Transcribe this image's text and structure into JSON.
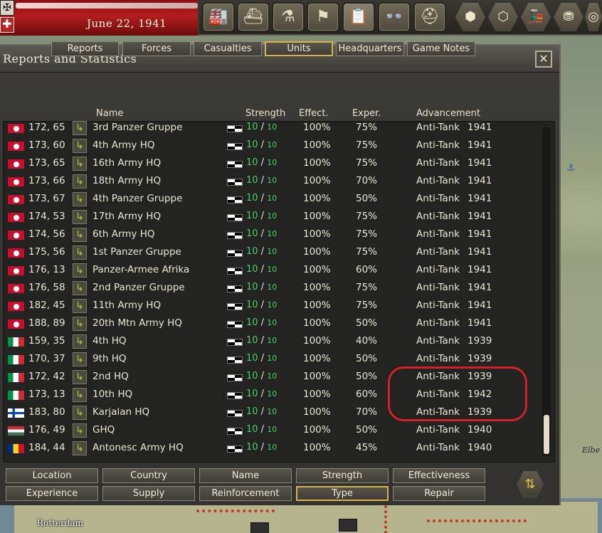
{
  "topbar": {
    "date": "June 22, 1941",
    "buttons": [
      {
        "name": "production-icon",
        "glyph": "🏭"
      },
      {
        "name": "ship-icon",
        "glyph": "⛴"
      },
      {
        "name": "research-icon",
        "glyph": "⚗"
      },
      {
        "name": "flag-icon",
        "glyph": "⚑"
      },
      {
        "name": "reports-icon",
        "glyph": "📋"
      },
      {
        "name": "binoculars-icon",
        "glyph": "👓"
      },
      {
        "name": "helmet-icon",
        "glyph": "⛑"
      }
    ],
    "hex_buttons": [
      {
        "name": "hex-view-icon",
        "glyph": "⬢"
      },
      {
        "name": "hex-grid-icon",
        "glyph": "⬡"
      },
      {
        "name": "train-icon",
        "glyph": "🚂"
      },
      {
        "name": "resources-icon",
        "glyph": "⛃"
      },
      {
        "name": "extra-icon",
        "glyph": "◎"
      }
    ]
  },
  "dialog": {
    "title": "Reports and Statistics",
    "close_glyph": "✕"
  },
  "tabs": [
    "Reports",
    "Forces",
    "Casualties",
    "Units",
    "Headquarters",
    "Game Notes"
  ],
  "active_tab": "Units",
  "columns": {
    "name": "Name",
    "strength": "Strength",
    "effect": "Effect.",
    "exper": "Exper.",
    "advancement": "Advancement"
  },
  "rows": [
    {
      "flag": "de",
      "coords": "172, 65",
      "name": "3rd Panzer Gruppe",
      "str": "10",
      "max": "10",
      "eff": "100%",
      "exp": "75%",
      "adv": "Anti-Tank",
      "year": "1941"
    },
    {
      "flag": "de",
      "coords": "173, 60",
      "name": "4th Army HQ",
      "str": "10",
      "max": "10",
      "eff": "100%",
      "exp": "75%",
      "adv": "Anti-Tank",
      "year": "1941"
    },
    {
      "flag": "de",
      "coords": "173, 65",
      "name": "16th Army HQ",
      "str": "10",
      "max": "10",
      "eff": "100%",
      "exp": "75%",
      "adv": "Anti-Tank",
      "year": "1941"
    },
    {
      "flag": "de",
      "coords": "173, 66",
      "name": "18th Army HQ",
      "str": "10",
      "max": "10",
      "eff": "100%",
      "exp": "70%",
      "adv": "Anti-Tank",
      "year": "1941"
    },
    {
      "flag": "de",
      "coords": "173, 67",
      "name": "4th Panzer Gruppe",
      "str": "10",
      "max": "10",
      "eff": "100%",
      "exp": "50%",
      "adv": "Anti-Tank",
      "year": "1941"
    },
    {
      "flag": "de",
      "coords": "174, 53",
      "name": "17th Army HQ",
      "str": "10",
      "max": "10",
      "eff": "100%",
      "exp": "75%",
      "adv": "Anti-Tank",
      "year": "1941"
    },
    {
      "flag": "de",
      "coords": "174, 56",
      "name": "6th Army HQ",
      "str": "10",
      "max": "10",
      "eff": "100%",
      "exp": "75%",
      "adv": "Anti-Tank",
      "year": "1941"
    },
    {
      "flag": "de",
      "coords": "175, 56",
      "name": "1st Panzer Gruppe",
      "str": "10",
      "max": "10",
      "eff": "100%",
      "exp": "75%",
      "adv": "Anti-Tank",
      "year": "1941"
    },
    {
      "flag": "de",
      "coords": "176, 13",
      "name": "Panzer-Armee Afrika",
      "str": "10",
      "max": "10",
      "eff": "100%",
      "exp": "60%",
      "adv": "Anti-Tank",
      "year": "1941"
    },
    {
      "flag": "de",
      "coords": "176, 58",
      "name": "2nd Panzer Gruppe",
      "str": "10",
      "max": "10",
      "eff": "100%",
      "exp": "75%",
      "adv": "Anti-Tank",
      "year": "1941"
    },
    {
      "flag": "de",
      "coords": "182, 45",
      "name": "11th Army HQ",
      "str": "10",
      "max": "10",
      "eff": "100%",
      "exp": "75%",
      "adv": "Anti-Tank",
      "year": "1941"
    },
    {
      "flag": "de",
      "coords": "188, 89",
      "name": "20th Mtn Army HQ",
      "str": "10",
      "max": "10",
      "eff": "100%",
      "exp": "50%",
      "adv": "Anti-Tank",
      "year": "1941"
    },
    {
      "flag": "it",
      "coords": "159, 35",
      "name": "4th HQ",
      "str": "10",
      "max": "10",
      "eff": "100%",
      "exp": "40%",
      "adv": "Anti-Tank",
      "year": "1939"
    },
    {
      "flag": "it",
      "coords": "170, 37",
      "name": "9th HQ",
      "str": "10",
      "max": "10",
      "eff": "100%",
      "exp": "50%",
      "adv": "Anti-Tank",
      "year": "1939"
    },
    {
      "flag": "it",
      "coords": "172, 42",
      "name": "2nd HQ",
      "str": "10",
      "max": "10",
      "eff": "100%",
      "exp": "50%",
      "adv": "Anti-Tank",
      "year": "1939"
    },
    {
      "flag": "it",
      "coords": "173, 13",
      "name": "10th HQ",
      "str": "10",
      "max": "10",
      "eff": "100%",
      "exp": "60%",
      "adv": "Anti-Tank",
      "year": "1942"
    },
    {
      "flag": "fi",
      "coords": "183, 80",
      "name": "Karjalan HQ",
      "str": "10",
      "max": "10",
      "eff": "100%",
      "exp": "70%",
      "adv": "Anti-Tank",
      "year": "1939"
    },
    {
      "flag": "hu",
      "coords": "176, 49",
      "name": "GHQ",
      "str": "10",
      "max": "10",
      "eff": "100%",
      "exp": "50%",
      "adv": "Anti-Tank",
      "year": "1940"
    },
    {
      "flag": "ro",
      "coords": "184, 44",
      "name": "Antonesc Army HQ",
      "str": "10",
      "max": "10",
      "eff": "100%",
      "exp": "45%",
      "adv": "Anti-Tank",
      "year": "1940"
    }
  ],
  "sort_buttons": [
    [
      "Location",
      "Country",
      "Name",
      "Strength",
      "Effectiveness"
    ],
    [
      "Experience",
      "Supply",
      "Reinforcement",
      "Type",
      "Repair"
    ]
  ],
  "active_sort": "Type",
  "swap_glyph": "⇅",
  "map": {
    "labels": [
      "Elbe"
    ],
    "cities": [
      "Rotterdam"
    ]
  },
  "colors": {
    "accent_border": "#d6b24a",
    "strength_green": "#4fd06a",
    "highlight_red": "#d3202b"
  }
}
